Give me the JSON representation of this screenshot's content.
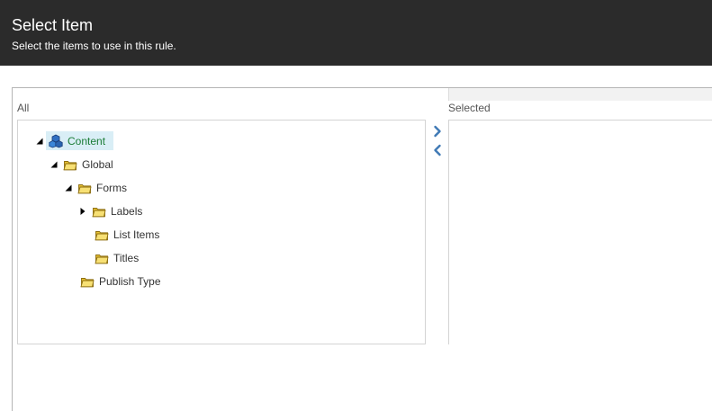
{
  "header": {
    "title": "Select Item",
    "subtitle": "Select the items to use in this rule."
  },
  "panels": {
    "all_label": "All",
    "selected_label": "Selected"
  },
  "buttons": {
    "move_right_icon": "chevron-right-icon",
    "move_left_icon": "chevron-left-icon"
  },
  "tree": {
    "root": {
      "label": "Content",
      "icon": "content-cubes-icon",
      "expanded": true,
      "selected": true
    },
    "global": {
      "label": "Global",
      "icon": "folder-icon",
      "expanded": true
    },
    "forms": {
      "label": "Forms",
      "icon": "folder-icon",
      "expanded": true
    },
    "labels": {
      "label": "Labels",
      "icon": "folder-icon",
      "expanded": false
    },
    "list_items": {
      "label": "List Items",
      "icon": "folder-icon"
    },
    "titles": {
      "label": "Titles",
      "icon": "folder-icon"
    },
    "publish_type": {
      "label": "Publish Type",
      "icon": "folder-icon"
    }
  },
  "colors": {
    "header_bg": "#2b2b2b",
    "selected_bg": "#d9eef6",
    "root_text": "#1c7d37",
    "chevron": "#3f79b5",
    "folder": "#f2d34c"
  }
}
